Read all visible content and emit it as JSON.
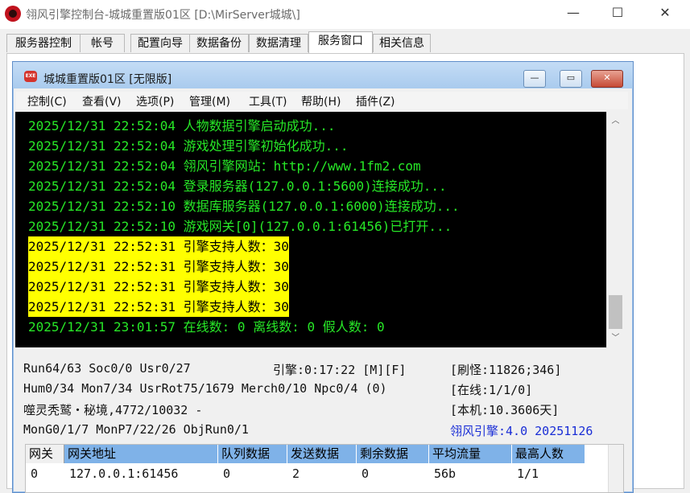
{
  "window": {
    "title": "翎风引擎控制台-城城重置版01区 [D:\\MirServer城城\\]",
    "controls": {
      "minimize": "—",
      "maximize": "☐",
      "close": "✕"
    }
  },
  "tabs": [
    {
      "label": "服务器控制"
    },
    {
      "label": "帐号"
    },
    {
      "label": "配置向导"
    },
    {
      "label": "数据备份"
    },
    {
      "label": "数据清理"
    },
    {
      "label": "服务窗口"
    },
    {
      "label": "相关信息"
    }
  ],
  "active_tab": "服务窗口",
  "child_window": {
    "icon_text": "EXE",
    "title": "城城重置版01区 [无限版]",
    "controls": {
      "minimize": "—",
      "maximize": "▭",
      "close": "✕"
    },
    "menu": [
      {
        "label": "控制(C)"
      },
      {
        "label": "查看(V)"
      },
      {
        "label": "选项(P)"
      },
      {
        "label": "管理(M)"
      },
      {
        "label": "工具(T)"
      },
      {
        "label": "帮助(H)"
      },
      {
        "label": "插件(Z)"
      }
    ]
  },
  "log": [
    {
      "text": "2025/12/31 22:52:04 人物数据引擎启动成功...",
      "highlight": false
    },
    {
      "text": "2025/12/31 22:52:04 游戏处理引擎初始化成功...",
      "highlight": false
    },
    {
      "text": "2025/12/31 22:52:04 翎风引擎网站：http://www.1fm2.com",
      "highlight": false
    },
    {
      "text": "2025/12/31 22:52:04 登录服务器(127.0.0.1:5600)连接成功...",
      "highlight": false
    },
    {
      "text": "2025/12/31 22:52:10 数据库服务器(127.0.0.1:6000)连接成功...",
      "highlight": false
    },
    {
      "text": "2025/12/31 22:52:10 游戏网关[0](127.0.0.1:61456)已打开...",
      "highlight": false
    },
    {
      "text": "2025/12/31 22:52:31 引擎支持人数：30",
      "highlight": true
    },
    {
      "text": "2025/12/31 22:52:31 引擎支持人数：30",
      "highlight": true
    },
    {
      "text": "2025/12/31 22:52:31 引擎支持人数：30",
      "highlight": true
    },
    {
      "text": "2025/12/31 22:52:31 引擎支持人数：30",
      "highlight": true
    },
    {
      "text": "2025/12/31 23:01:57 在线数: 0 离线数: 0 假人数: 0",
      "highlight": false
    }
  ],
  "status": {
    "run": "Run64/63 Soc0/0 Usr0/27",
    "engine_time": "引擎:0:17:22 [M][F]",
    "refresh": "[刷怪:11826;346]",
    "hum": "Hum0/34 Mon7/34 UsrRot75/1679 Merch0/10 Npc0/4 (0)",
    "online": "[在线:1/1/0]",
    "map": "噬灵秃鹫・秘境,4772/10032 -",
    "local": "[本机:10.3606天]",
    "mon": "MonG0/1/7 MonP7/22/26 ObjRun0/1",
    "version": "翎风引擎:4.0 20251126"
  },
  "grid": {
    "headers": [
      "网关",
      "网关地址",
      "队列数据",
      "发送数据",
      "剩余数据",
      "平均流量",
      "最高人数"
    ],
    "rows": [
      [
        "0",
        "127.0.0.1:61456",
        "0",
        "2",
        "0",
        "56b",
        "1/1"
      ]
    ]
  },
  "colors": {
    "log_bg": "#000000",
    "log_text": "#27e827",
    "highlight_bg": "#ffff00",
    "grid_header": "#7fb2e8",
    "version_text": "#1a2ed6"
  }
}
